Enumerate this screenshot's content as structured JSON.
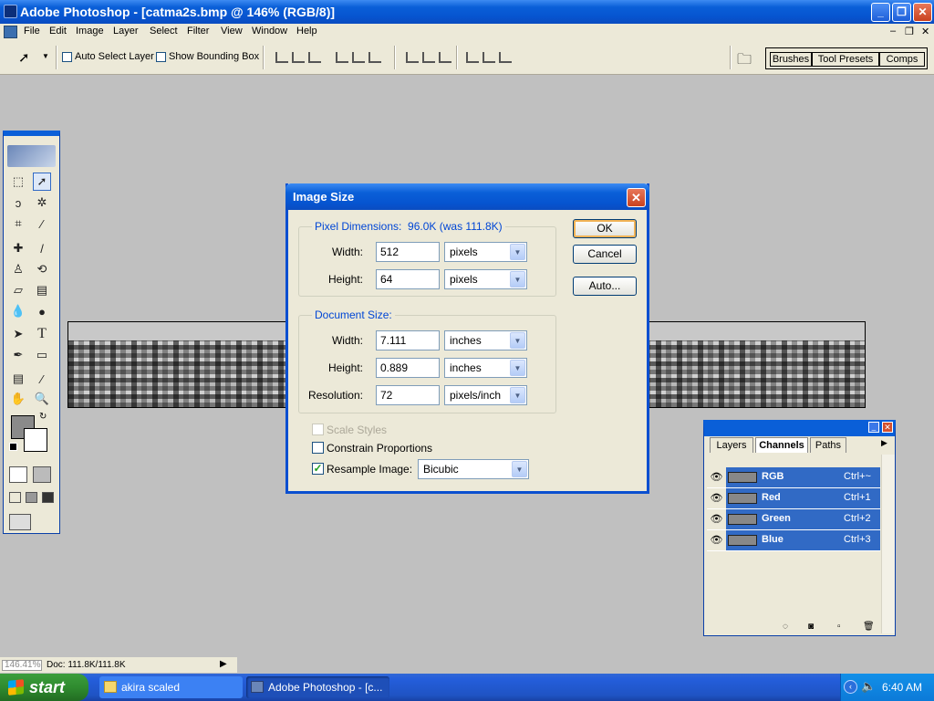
{
  "window": {
    "title": "Adobe Photoshop - [catma2s.bmp @ 146% (RGB/8)]"
  },
  "menu": [
    "File",
    "Edit",
    "Image",
    "Layer",
    "Select",
    "Filter",
    "View",
    "Window",
    "Help"
  ],
  "options_bar": {
    "auto_select_layer": "Auto Select Layer",
    "show_bounding_box": "Show Bounding Box",
    "palette_well_tabs": [
      "Brushes",
      "Tool Presets",
      "Comps"
    ]
  },
  "dialog": {
    "title": "Image Size",
    "pixel_dimensions": {
      "label": "Pixel Dimensions:",
      "size": "96.0K (was 111.8K)",
      "width_label": "Width:",
      "width_value": "512",
      "width_unit": "pixels",
      "height_label": "Height:",
      "height_value": "64",
      "height_unit": "pixels"
    },
    "document_size": {
      "label": "Document Size:",
      "width_label": "Width:",
      "width_value": "7.111",
      "width_unit": "inches",
      "height_label": "Height:",
      "height_value": "0.889",
      "height_unit": "inches",
      "resolution_label": "Resolution:",
      "resolution_value": "72",
      "resolution_unit": "pixels/inch"
    },
    "checkboxes": {
      "scale_styles": {
        "label": "Scale Styles",
        "checked": false,
        "enabled": false
      },
      "constrain_proportions": {
        "label": "Constrain Proportions",
        "checked": false,
        "enabled": true
      },
      "resample_image": {
        "label": "Resample Image:",
        "checked": true,
        "enabled": true
      }
    },
    "resample_method": "Bicubic",
    "buttons": {
      "ok": "OK",
      "cancel": "Cancel",
      "auto": "Auto..."
    }
  },
  "channels_palette": {
    "tabs": [
      "Layers",
      "Channels",
      "Paths"
    ],
    "active_tab": "Channels",
    "channels": [
      {
        "name": "RGB",
        "shortcut": "Ctrl+~"
      },
      {
        "name": "Red",
        "shortcut": "Ctrl+1"
      },
      {
        "name": "Green",
        "shortcut": "Ctrl+2"
      },
      {
        "name": "Blue",
        "shortcut": "Ctrl+3"
      }
    ]
  },
  "status_bar": {
    "zoom": "146.41%",
    "doc": "Doc: 111.8K/111.8K"
  },
  "taskbar": {
    "start": "start",
    "tasks": [
      "akira scaled",
      "Adobe Photoshop - [c..."
    ],
    "clock": "6:40 AM"
  }
}
